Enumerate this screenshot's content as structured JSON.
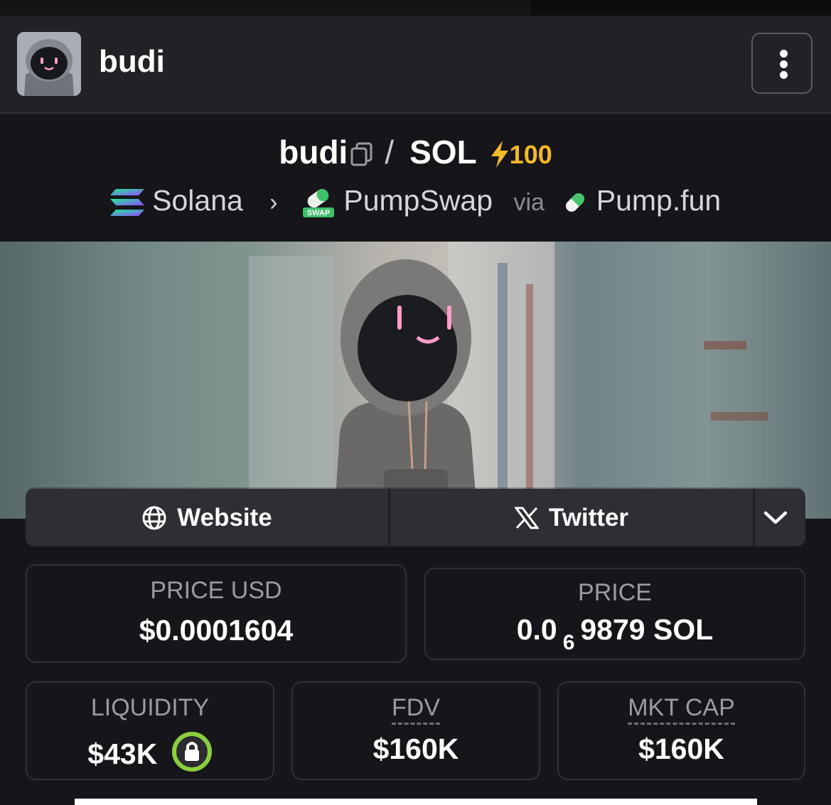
{
  "header": {
    "token_name": "budi"
  },
  "pair": {
    "base": "budi",
    "separator": "/",
    "quote": "SOL",
    "boost_value": "100"
  },
  "route": {
    "chain": "Solana",
    "dex": "PumpSwap",
    "dex_badge": "SWAP",
    "via_label": "via",
    "launchpad": "Pump.fun"
  },
  "links": {
    "website_label": "Website",
    "twitter_label": "Twitter"
  },
  "stats": {
    "price_usd": {
      "label": "PRICE USD",
      "value": "$0.0001604"
    },
    "price_native": {
      "label": "PRICE",
      "prefix": "0.0",
      "zeros": "6",
      "digits": "9879",
      "unit": "SOL"
    },
    "liquidity": {
      "label": "LIQUIDITY",
      "value": "$43K"
    },
    "fdv": {
      "label": "FDV",
      "value": "$160K"
    },
    "mkt_cap": {
      "label": "MKT CAP",
      "value": "$160K"
    }
  },
  "colors": {
    "boost": "#f5b828",
    "lock_ring": "#8ccf3e",
    "background": "#16161a"
  },
  "icons": [
    "more-vertical-icon",
    "copy-icon",
    "lightning-icon",
    "solana-icon",
    "chevron-right-icon",
    "pumpswap-icon",
    "pill-icon",
    "globe-icon",
    "x-logo-icon",
    "chevron-down-icon",
    "lock-icon"
  ]
}
